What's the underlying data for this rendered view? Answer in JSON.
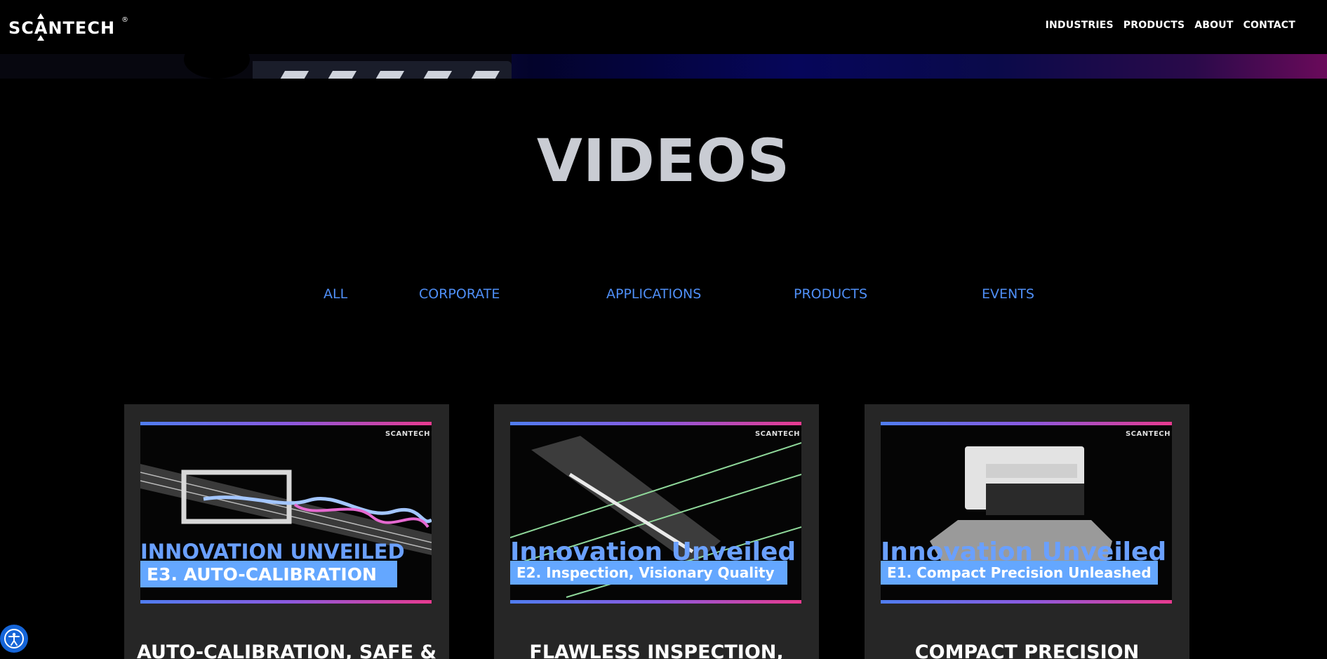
{
  "header": {
    "logo_text": "SCANTECH",
    "logo_reg": "®",
    "nav": [
      "INDUSTRIES",
      "PRODUCTS",
      "ABOUT",
      "CONTACT"
    ]
  },
  "page": {
    "title": "VIDEOS"
  },
  "filters": {
    "tabs": [
      "ALL",
      "CORPORATE",
      "APPLICATIONS",
      "PRODUCTS",
      "EVENTS"
    ]
  },
  "cards": [
    {
      "thumb_brand": "SCANTECH",
      "thumb_line1": "INNOVATION UNVEILED",
      "thumb_line2": "E3. AUTO-CALIBRATION",
      "title": "AUTO-CALIBRATION, SAFE &"
    },
    {
      "thumb_brand": "SCANTECH",
      "thumb_line1": "Innovation Unveiled",
      "thumb_line2": "E2. Inspection, Visionary Quality",
      "title": "FLAWLESS INSPECTION,"
    },
    {
      "thumb_brand": "SCANTECH",
      "thumb_line1": "Innovation Unveiled",
      "thumb_line2": "E1. Compact Precision Unleashed",
      "title": "COMPACT PRECISION"
    }
  ],
  "colors": {
    "accent": "#4f8ff7",
    "background": "#000000",
    "card": "#262626",
    "title": "#c9ccd3"
  },
  "icons": {
    "accessibility": "accessibility-icon"
  }
}
